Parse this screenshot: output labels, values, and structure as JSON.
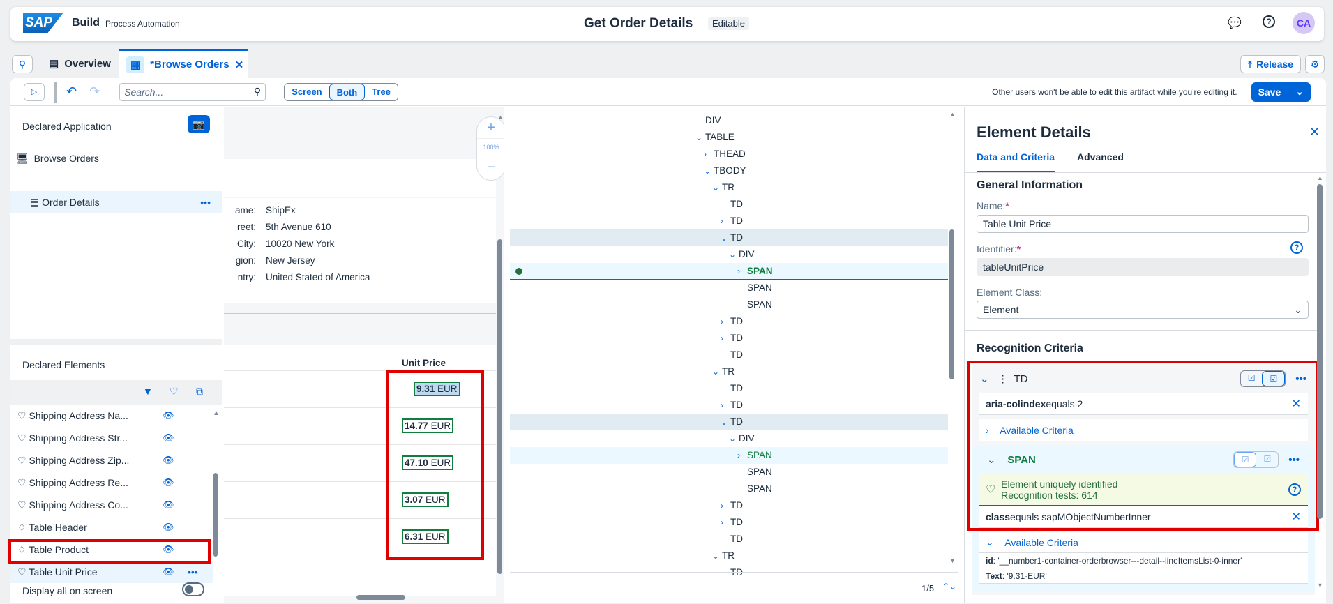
{
  "header": {
    "logo": "SAP",
    "product": "Build",
    "subtitle": "Process Automation",
    "title": "Get Order Details",
    "status": "Editable",
    "avatar": "CA",
    "icons": [
      "feedback-icon",
      "help-icon"
    ]
  },
  "tabs": {
    "overview": "Overview",
    "active": "*Browse Orders",
    "release": "Release"
  },
  "toolbar": {
    "search_placeholder": "Search...",
    "views": [
      "Screen",
      "Both",
      "Tree"
    ],
    "selected_view": "Both",
    "notice": "Other users won't be able to edit this artifact while you're editing it.",
    "save": "Save"
  },
  "left": {
    "declared_app_title": "Declared Application",
    "app_items": [
      {
        "label": "Browse Orders"
      },
      {
        "label": "Order Details"
      }
    ],
    "declared_elements_title": "Declared Elements",
    "elements": [
      "Shipping Address Na...",
      "Shipping Address Str...",
      "Shipping Address Zip...",
      "Shipping Address Re...",
      "Shipping Address Co...",
      "Table Header",
      "Table Product",
      "Table Unit Price"
    ],
    "selected_element": "Table Unit Price",
    "display_all": "Display all on screen",
    "display_all_on": false
  },
  "screen": {
    "zoom": "100%",
    "address": [
      {
        "label": "ame:",
        "value": "ShipEx"
      },
      {
        "label": "reet:",
        "value": "5th Avenue 610"
      },
      {
        "label": "City:",
        "value": "10020 New York"
      },
      {
        "label": "gion:",
        "value": "New Jersey"
      },
      {
        "label": "ntry:",
        "value": "United Stated of America"
      }
    ],
    "column_header": "Unit Price",
    "prices": [
      {
        "num": "9.31",
        "cur": "EUR"
      },
      {
        "num": "14.77",
        "cur": "EUR"
      },
      {
        "num": "47.10",
        "cur": "EUR"
      },
      {
        "num": "3.07",
        "cur": "EUR"
      },
      {
        "num": "6.31",
        "cur": "EUR"
      }
    ]
  },
  "tree": {
    "rows": [
      {
        "t": "DIV",
        "l": 0,
        "c": ""
      },
      {
        "t": "TABLE",
        "l": 0,
        "c": "down"
      },
      {
        "t": "THEAD",
        "l": 1,
        "c": "right"
      },
      {
        "t": "TBODY",
        "l": 1,
        "c": "down"
      },
      {
        "t": "TR",
        "l": 2,
        "c": "down"
      },
      {
        "t": "TD",
        "l": 3,
        "c": ""
      },
      {
        "t": "TD",
        "l": 3,
        "c": "right"
      },
      {
        "t": "TD",
        "l": 3,
        "c": "down",
        "s": "hl"
      },
      {
        "t": "DIV",
        "l": 4,
        "c": "down"
      },
      {
        "t": "SPAN",
        "l": 5,
        "c": "right",
        "s": "sel"
      },
      {
        "t": "SPAN",
        "l": 5,
        "c": ""
      },
      {
        "t": "SPAN",
        "l": 5,
        "c": ""
      },
      {
        "t": "TD",
        "l": 3,
        "c": "right"
      },
      {
        "t": "TD",
        "l": 3,
        "c": "right"
      },
      {
        "t": "TD",
        "l": 3,
        "c": ""
      },
      {
        "t": "TR",
        "l": 2,
        "c": "down"
      },
      {
        "t": "TD",
        "l": 3,
        "c": ""
      },
      {
        "t": "TD",
        "l": 3,
        "c": "right"
      },
      {
        "t": "TD",
        "l": 3,
        "c": "down",
        "s": "hl"
      },
      {
        "t": "DIV",
        "l": 4,
        "c": "down"
      },
      {
        "t": "SPAN",
        "l": 5,
        "c": "right",
        "s": "match"
      },
      {
        "t": "SPAN",
        "l": 5,
        "c": ""
      },
      {
        "t": "SPAN",
        "l": 5,
        "c": ""
      },
      {
        "t": "TD",
        "l": 3,
        "c": "right"
      },
      {
        "t": "TD",
        "l": 3,
        "c": "right"
      },
      {
        "t": "TD",
        "l": 3,
        "c": ""
      },
      {
        "t": "TR",
        "l": 2,
        "c": "down"
      },
      {
        "t": "TD",
        "l": 3,
        "c": ""
      }
    ],
    "pager": "1/5"
  },
  "details": {
    "title": "Element Details",
    "tabs": [
      "Data and Criteria",
      "Advanced"
    ],
    "general": "General Information",
    "name_label": "Name:",
    "name": "Table Unit Price",
    "identifier_label": "Identifier:",
    "identifier": "tableUnitPrice",
    "class_label": "Element Class:",
    "class": "Element",
    "recognition": "Recognition Criteria",
    "td": {
      "tag": "TD",
      "criterion_key": "aria-colindex",
      "criterion_rest": " equals 2",
      "available": "Available Criteria"
    },
    "span": {
      "tag": "SPAN",
      "status1": "Element uniquely identified",
      "status2": "Recognition tests: 614",
      "criterion_key": "class",
      "criterion_rest": " equals sapMObjectNumberInner",
      "available": "Available Criteria",
      "attrs": [
        {
          "k": "id",
          "v": ": '__number1-container-orderbrowser---detail--lineItemsList-0-inner'"
        },
        {
          "k": "Text",
          "v": ": '9.31·EUR'"
        }
      ]
    }
  },
  "colors": {
    "accent": "#0064d9",
    "highlight": "#e00000",
    "success": "#107e3e"
  }
}
